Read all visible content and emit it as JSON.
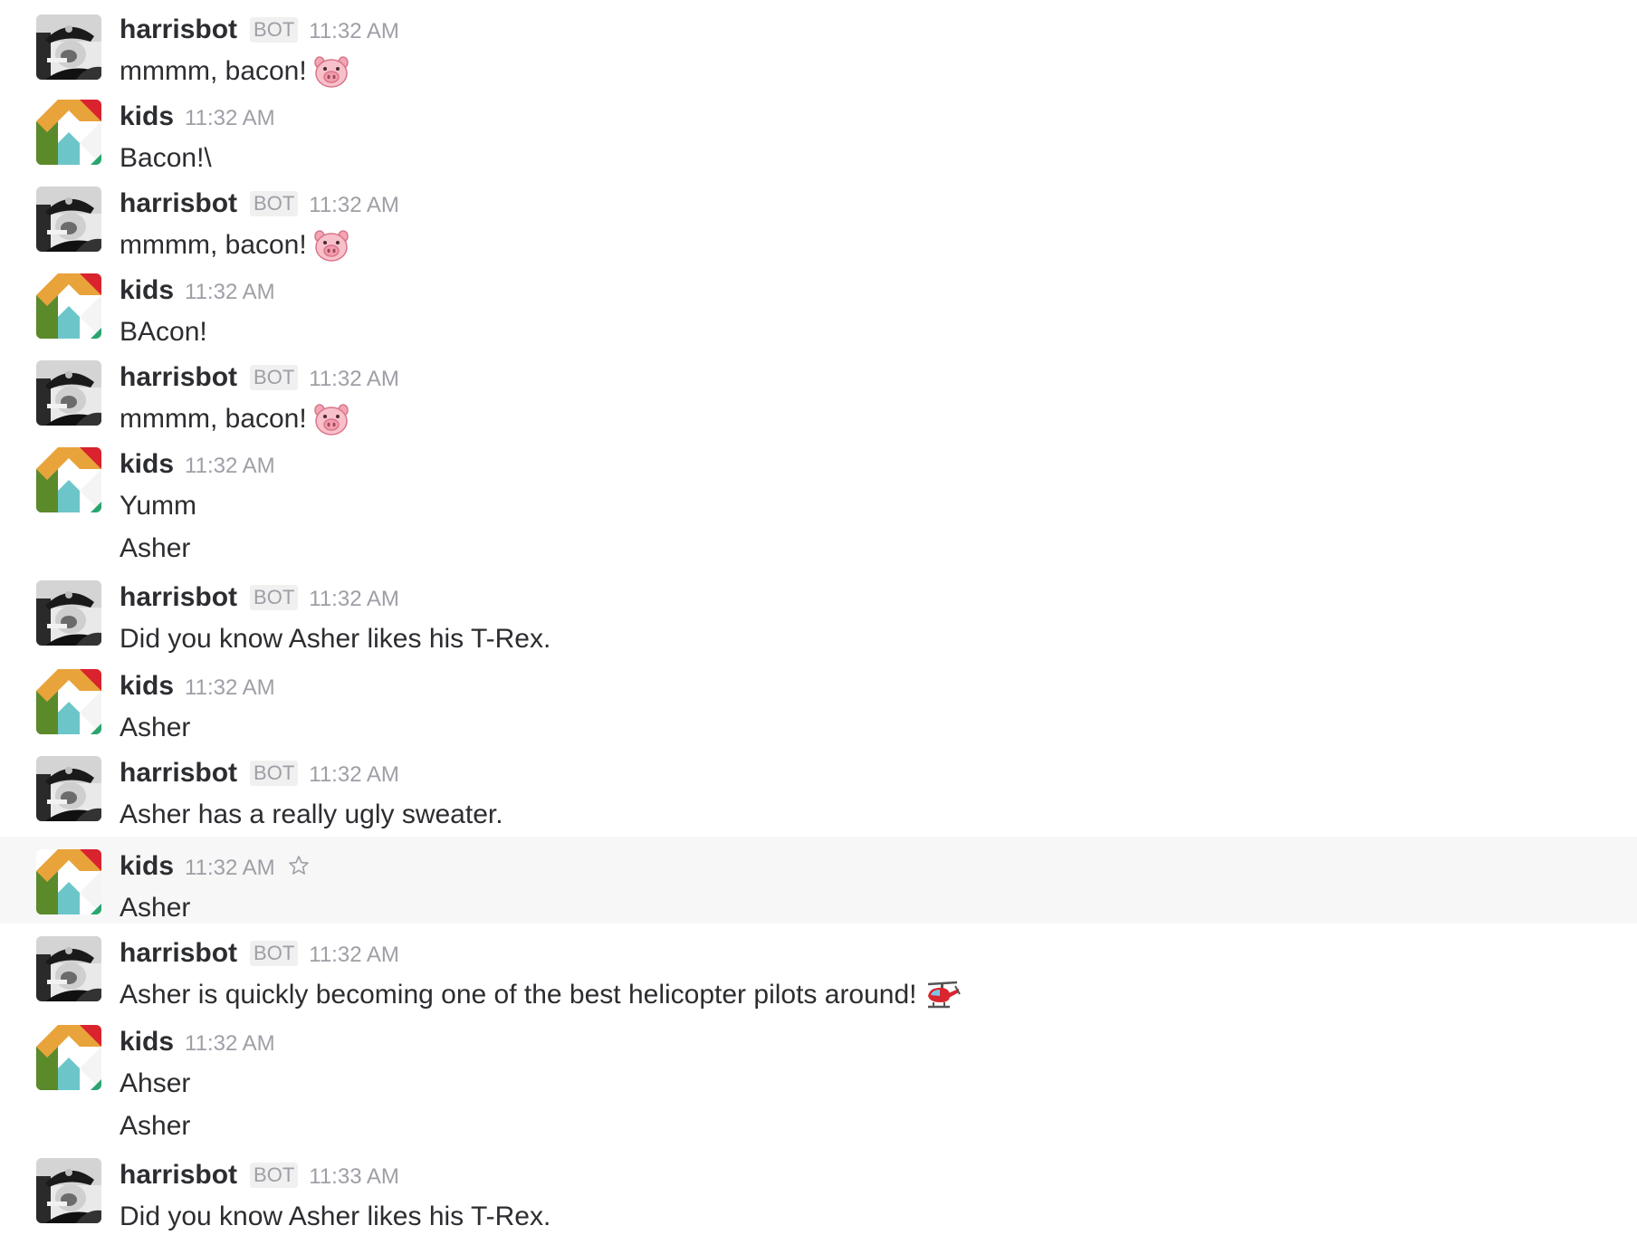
{
  "colors": {
    "username": "#2c2d30",
    "timestamp": "#9e9ea6",
    "bot_badge_bg": "#f0f0f0",
    "hover_bg": "#f7f7f7",
    "kids_avatar_orange": "#e8a33a",
    "kids_avatar_red": "#d9232e",
    "kids_avatar_green": "#5a8a2a",
    "kids_avatar_teal": "#6cc6c9"
  },
  "messages": [
    {
      "user": "harrisbot",
      "badge": "BOT",
      "time": "11:32 AM",
      "avatar": "bot-photo",
      "lines": [
        "mmmm, bacon!"
      ],
      "emoji": "pig-face-icon"
    },
    {
      "user": "kids",
      "time": "11:32 AM",
      "avatar": "kids-logo",
      "lines": [
        "Bacon!\\"
      ]
    },
    {
      "user": "harrisbot",
      "badge": "BOT",
      "time": "11:32 AM",
      "avatar": "bot-photo",
      "lines": [
        "mmmm, bacon!"
      ],
      "emoji": "pig-face-icon"
    },
    {
      "user": "kids",
      "time": "11:32 AM",
      "avatar": "kids-logo",
      "lines": [
        "BAcon!"
      ]
    },
    {
      "user": "harrisbot",
      "badge": "BOT",
      "time": "11:32 AM",
      "avatar": "bot-photo",
      "lines": [
        "mmmm, bacon!"
      ],
      "emoji": "pig-face-icon"
    },
    {
      "user": "kids",
      "time": "11:32 AM",
      "avatar": "kids-logo",
      "lines": [
        "Yumm",
        "Asher"
      ]
    },
    {
      "user": "harrisbot",
      "badge": "BOT",
      "time": "11:32 AM",
      "avatar": "bot-photo",
      "lines": [
        "Did you know Asher likes his T-Rex."
      ]
    },
    {
      "user": "kids",
      "time": "11:32 AM",
      "avatar": "kids-logo",
      "lines": [
        "Asher"
      ]
    },
    {
      "user": "harrisbot",
      "badge": "BOT",
      "time": "11:32 AM",
      "avatar": "bot-photo",
      "lines": [
        "Asher has a really ugly sweater."
      ]
    },
    {
      "user": "kids",
      "time": "11:32 AM",
      "avatar": "kids-logo",
      "lines": [
        "Asher"
      ],
      "hovered": true,
      "star_icon": "star-outline-icon"
    },
    {
      "user": "harrisbot",
      "badge": "BOT",
      "time": "11:32 AM",
      "avatar": "bot-photo",
      "lines": [
        "Asher is quickly becoming one of the best helicopter pilots around!"
      ],
      "emoji": "helicopter-icon"
    },
    {
      "user": "kids",
      "time": "11:32 AM",
      "avatar": "kids-logo",
      "lines": [
        "Ahser",
        "Asher"
      ]
    },
    {
      "user": "harrisbot",
      "badge": "BOT",
      "time": "11:33 AM",
      "avatar": "bot-photo",
      "lines": [
        "Did you know Asher likes his T-Rex."
      ]
    }
  ]
}
